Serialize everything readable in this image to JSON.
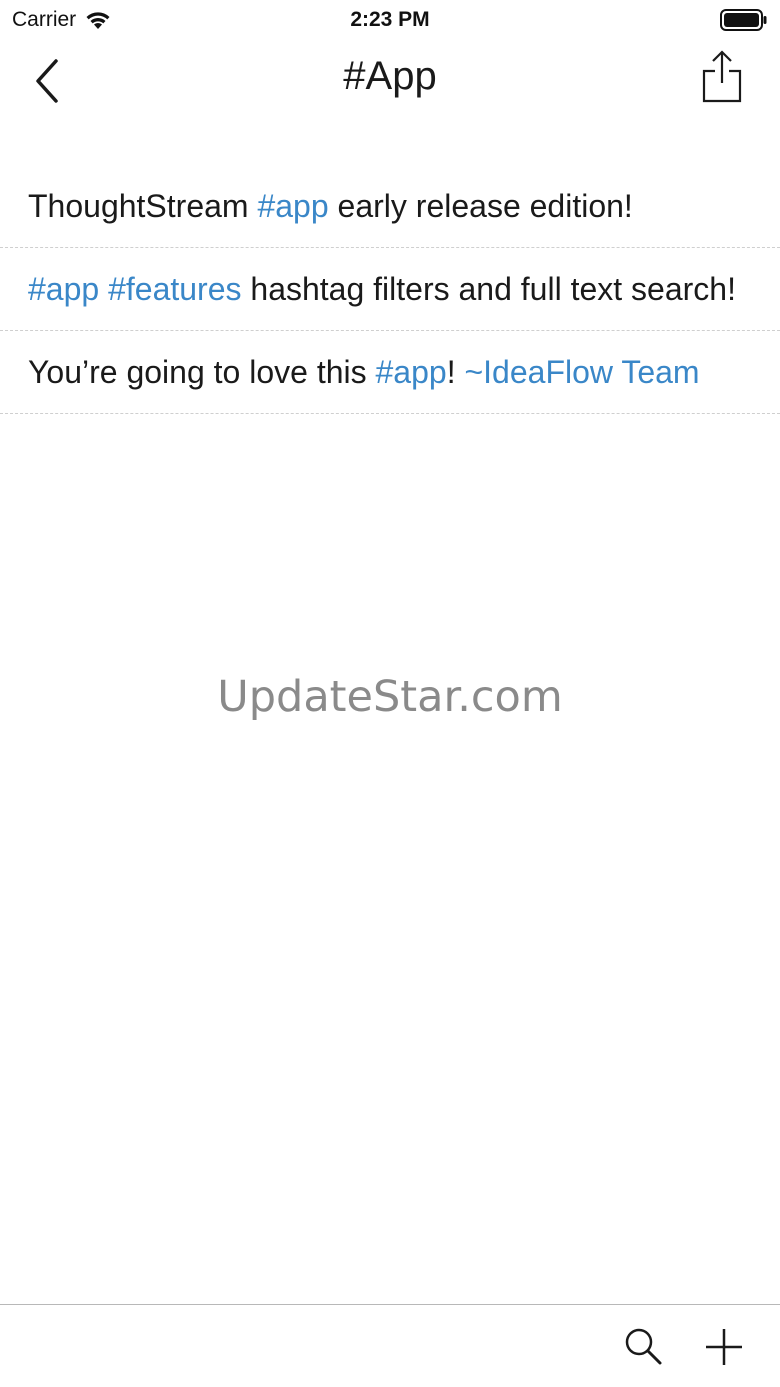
{
  "status_bar": {
    "carrier": "Carrier",
    "time": "2:23 PM",
    "wifi_icon": "wifi-icon",
    "battery_icon": "battery-full-icon"
  },
  "nav": {
    "title": "#App",
    "back_icon": "chevron-left-icon",
    "share_icon": "share-icon"
  },
  "thoughts": [
    {
      "segments": [
        {
          "text": "ThoughtStream ",
          "tag": false
        },
        {
          "text": "#app",
          "tag": true
        },
        {
          "text": " early release edition!",
          "tag": false
        }
      ]
    },
    {
      "segments": [
        {
          "text": "#app",
          "tag": true
        },
        {
          "text": " ",
          "tag": false
        },
        {
          "text": "#features",
          "tag": true
        },
        {
          "text": " hashtag filters and full text search!",
          "tag": false
        }
      ]
    },
    {
      "segments": [
        {
          "text": "You’re going to love this ",
          "tag": false
        },
        {
          "text": "#app",
          "tag": true
        },
        {
          "text": "! ",
          "tag": false
        },
        {
          "text": "~IdeaFlow Team",
          "tag": true
        }
      ]
    }
  ],
  "watermark": "UpdateStar.com",
  "toolbar": {
    "search_icon": "search-icon",
    "add_icon": "plus-icon"
  },
  "colors": {
    "tag": "#3a87c8",
    "text": "#1a1a1a",
    "watermark": "#8a8a8a"
  }
}
